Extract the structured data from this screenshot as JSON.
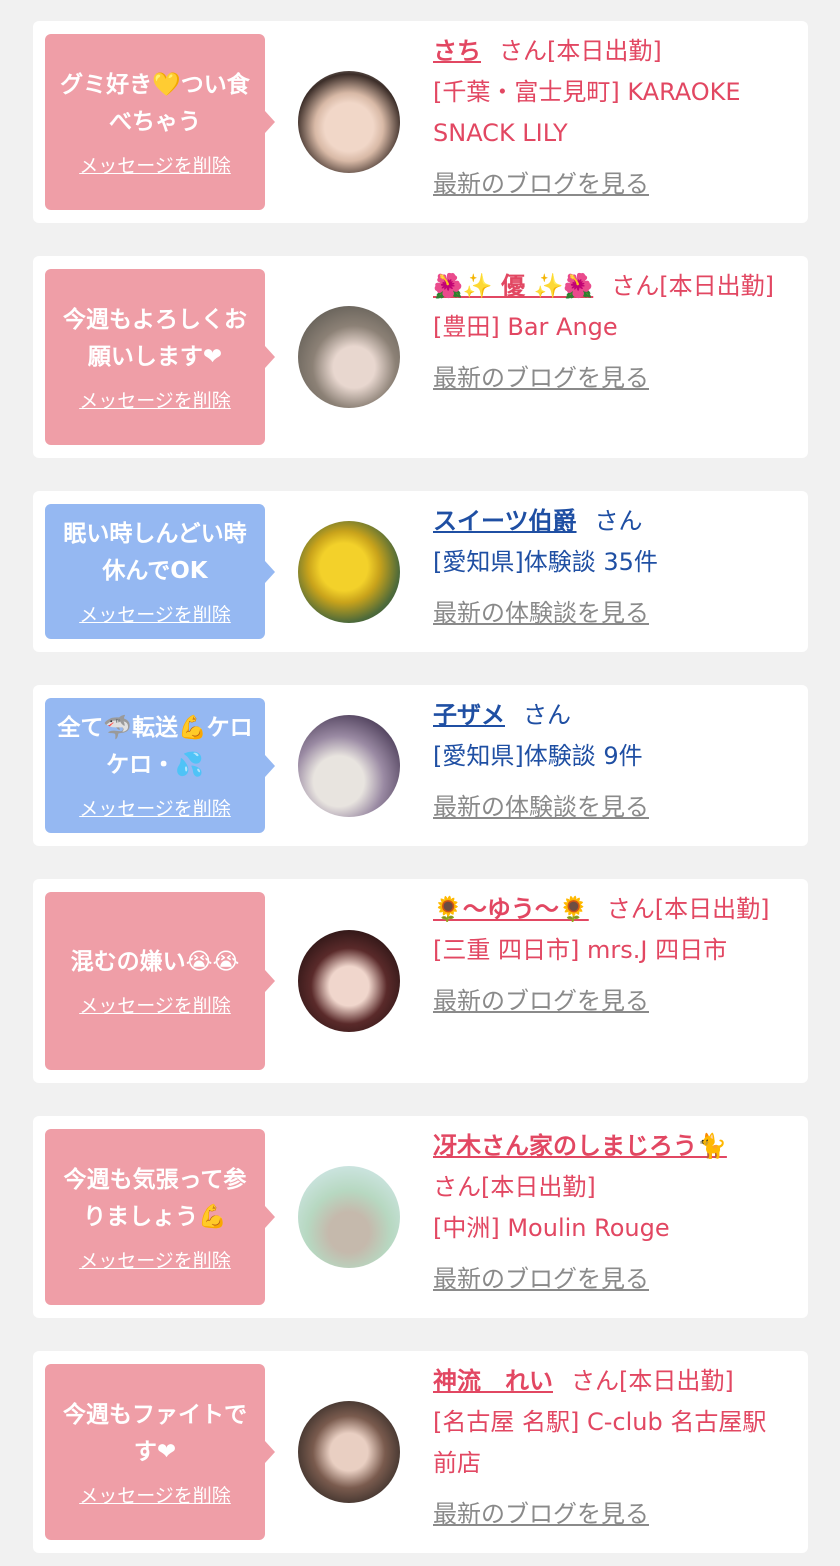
{
  "colors": {
    "card_bg": "#ffffff",
    "page_bg": "#f1f1f1",
    "bubble_pink": "#ef9ea7",
    "bubble_blue": "#95b8f2",
    "cast_text": "#e24762",
    "user_text": "#1f4fa3",
    "link_gray": "#8a8a8a"
  },
  "delete_label": "メッセージを削除",
  "items": [
    {
      "message": "グミ好き💛つい食べちゃう",
      "name": "さち",
      "suffix": "さん[本日出勤]",
      "shop": "[千葉・富士見町] KARAOKE SNACK LILY",
      "link": "最新のブログを見る",
      "bubble": "pink"
    },
    {
      "message": "今週もよろしくお願いします❤",
      "name": "🌺✨ 優 ✨🌺",
      "suffix": "さん[本日出勤]",
      "shop": "[豊田] Bar Ange",
      "link": "最新のブログを見る",
      "bubble": "pink"
    },
    {
      "message": "眠い時しんどい時休んでOK",
      "name": "スイーツ伯爵",
      "suffix": "さん",
      "shop": "[愛知県]体験談 35件",
      "link": "最新の体験談を見る",
      "bubble": "blue"
    },
    {
      "message": "全て🦈転送💪ケロケロ・💦",
      "name": "子ザメ",
      "suffix": "さん",
      "shop": "[愛知県]体験談 9件",
      "link": "最新の体験談を見る",
      "bubble": "blue"
    },
    {
      "message": "混むの嫌い😭😭",
      "name": "🌻〜ゆう〜🌻",
      "suffix": "さん[本日出勤]",
      "shop": "[三重 四日市] mrs.J 四日市",
      "link": "最新のブログを見る",
      "bubble": "pink"
    },
    {
      "message": "今週も気張って参りましょう💪",
      "name": "冴木さん家のしまじろう🐈",
      "suffix": "さん[本日出勤]",
      "shop": "[中洲] Moulin Rouge",
      "link": "最新のブログを見る",
      "bubble": "pink"
    },
    {
      "message": "今週もファイトです❤",
      "name": "神流　れい",
      "suffix": "さん[本日出勤]",
      "shop": "[名古屋 名駅] C-club 名古屋駅前店",
      "link": "最新のブログを見る",
      "bubble": "pink"
    }
  ]
}
